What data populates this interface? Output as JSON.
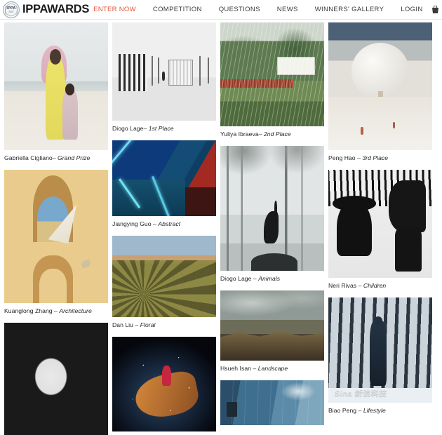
{
  "nav": {
    "logo": {
      "icon": "ippa-seal-logo",
      "badge_text": "IPPA",
      "badge_year": "2007"
    },
    "brand": "IPPAWARDS",
    "enter_now": "ENTER NOW",
    "accent_color": "#e4553b",
    "links": [
      {
        "label": "COMPETITION",
        "name": "nav-link-competition"
      },
      {
        "label": "QUESTIONS",
        "name": "nav-link-questions"
      },
      {
        "label": "NEWS",
        "name": "nav-link-news"
      },
      {
        "label": "WINNERS' GALLERY",
        "name": "nav-link-winners-gallery"
      },
      {
        "label": "LOGIN",
        "name": "nav-link-login"
      }
    ],
    "cart": {
      "icon": "shopping-cart-icon",
      "count": "0"
    },
    "menu": {
      "icon": "hamburger-menu-icon"
    }
  },
  "gallery": {
    "columns": [
      {
        "name": "gallery-column-1",
        "tiles": [
          {
            "photographer": "Gabriella Cigliano",
            "separator": "– ",
            "award": "Grand Prize",
            "caption": "Gabriella Cigliano– Grand Prize",
            "art": "ph-beach",
            "alt": "woman in yellow dress with child on beach"
          },
          {
            "photographer": "Kuanglong Zhang",
            "separator": " – ",
            "award": "Architecture",
            "caption": "Kuanglong Zhang – Architecture",
            "art": "ph-arch-yellow",
            "alt": "yellow wall with arched windows and kite"
          },
          {
            "photographer": "",
            "separator": "",
            "award": "",
            "caption": "",
            "art": "ph-fish",
            "alt": "black and white school of fish swirling"
          }
        ]
      },
      {
        "name": "gallery-column-2",
        "tiles": [
          {
            "photographer": "Diogo Lage",
            "separator": "– ",
            "award": "1st Place",
            "caption": "Diogo Lage– 1st Place",
            "art": "ph-bw-beach",
            "alt": "black and white beach huts"
          },
          {
            "photographer": "Jiangying Guo",
            "separator": " – ",
            "award": "Abstract",
            "caption": "Jiangying Guo – Abstract",
            "art": "ph-abstract",
            "alt": "blue and red abstract light beams"
          },
          {
            "photographer": "Dan Liu",
            "separator": " – ",
            "award": "Floral",
            "caption": "Dan Liu – Floral",
            "art": "ph-succulent",
            "alt": "desert succulents landscape"
          },
          {
            "photographer": "",
            "separator": "",
            "award": "",
            "caption": "",
            "art": "ph-dragon",
            "alt": "dragon boat water splash at night"
          }
        ]
      },
      {
        "name": "gallery-column-3",
        "tiles": [
          {
            "photographer": "Yuliya Ibraeva",
            "separator": "– ",
            "award": "2nd Place",
            "caption": "Yuliya Ibraeva– 2nd Place",
            "art": "ph-rain-theater",
            "alt": "outdoor cinema screen in rain"
          },
          {
            "photographer": "Diogo Lage",
            "separator": " – ",
            "award": "Animals",
            "caption": "Diogo Lage – Animals",
            "art": "ph-crane",
            "alt": "crane bird in misty forest"
          },
          {
            "photographer": "Hsueh Isan",
            "separator": " – ",
            "award": "Landscape",
            "caption": "Hsueh Isan – Landscape",
            "art": "ph-landscape",
            "alt": "dark mountain ridge landscape"
          },
          {
            "photographer": "",
            "separator": "",
            "award": "",
            "caption": "",
            "art": "ph-blue-building",
            "alt": "blue glass building facade"
          }
        ]
      },
      {
        "name": "gallery-column-4",
        "tiles": [
          {
            "photographer": "Peng Hao",
            "separator": " – ",
            "award": "3rd Place",
            "caption": "Peng Hao – 3rd Place",
            "art": "ph-balloon",
            "alt": "white sphere balloon in desert haze"
          },
          {
            "photographer": "Neri Rivas",
            "separator": " – ",
            "award": "Children",
            "caption": "Neri Rivas – Children",
            "art": "ph-children-bw",
            "alt": "black and white silhouette of children"
          },
          {
            "photographer": "Biao Peng",
            "separator": " – ",
            "award": "Lifestyle",
            "caption": "Biao Peng – Lifestyle",
            "art": "ph-forest-man",
            "alt": "man standing in snowy birch forest",
            "watermark": "Sina 新浪科技"
          }
        ]
      }
    ]
  }
}
